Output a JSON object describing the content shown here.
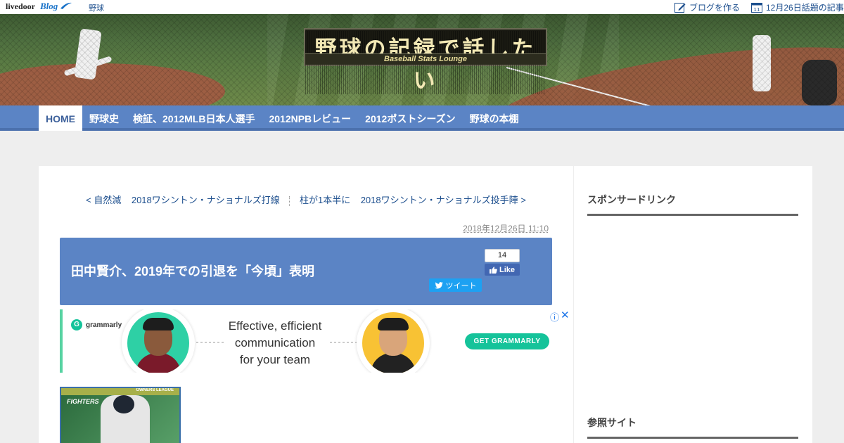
{
  "topbar": {
    "logo": "livedoor",
    "logo_sub": "Blog",
    "category": "野球",
    "write_blog": "ブログを作る",
    "trending": "12月26日話題の記事"
  },
  "header": {
    "title": "野球の記録で話したい",
    "subtitle": "Baseball Stats Lounge"
  },
  "nav": {
    "items": [
      {
        "label": "HOME"
      },
      {
        "label": "野球史"
      },
      {
        "label": "検証、2012MLB日本人選手"
      },
      {
        "label": "2012NPBレビュー"
      },
      {
        "label": "2012ポストシーズン"
      },
      {
        "label": "野球の本棚"
      }
    ]
  },
  "post_nav": {
    "prev1": "< 自然減",
    "prev2": "2018ワシントン・ナショナルズ打線",
    "next1": "柱が1本半に",
    "next2": "2018ワシントン・ナショナルズ投手陣 >"
  },
  "article": {
    "date": "2018年12月26日 11:10",
    "title": "田中賢介、2019年での引退を「今頃」表明",
    "fb_count": "14",
    "fb_like": "Like",
    "tweet": "ツイート"
  },
  "ad": {
    "brand": "grammarly",
    "line1": "Effective, efficient",
    "line2": "communication",
    "line3": "for your team",
    "cta": "GET GRAMMARLY",
    "info": "ⓘ",
    "close": "✕"
  },
  "card": {
    "team": "FIGHTERS",
    "league": "OWNERS LEAGUE"
  },
  "sidebar": {
    "sponsor": "スポンサードリンク",
    "reference": "参照サイト"
  },
  "colors": {
    "nav_blue": "#5b84c5",
    "link_blue": "#1d4f8e",
    "grammarly_green": "#15c39a",
    "facebook_blue": "#4267b2",
    "twitter_blue": "#1da1f2"
  }
}
